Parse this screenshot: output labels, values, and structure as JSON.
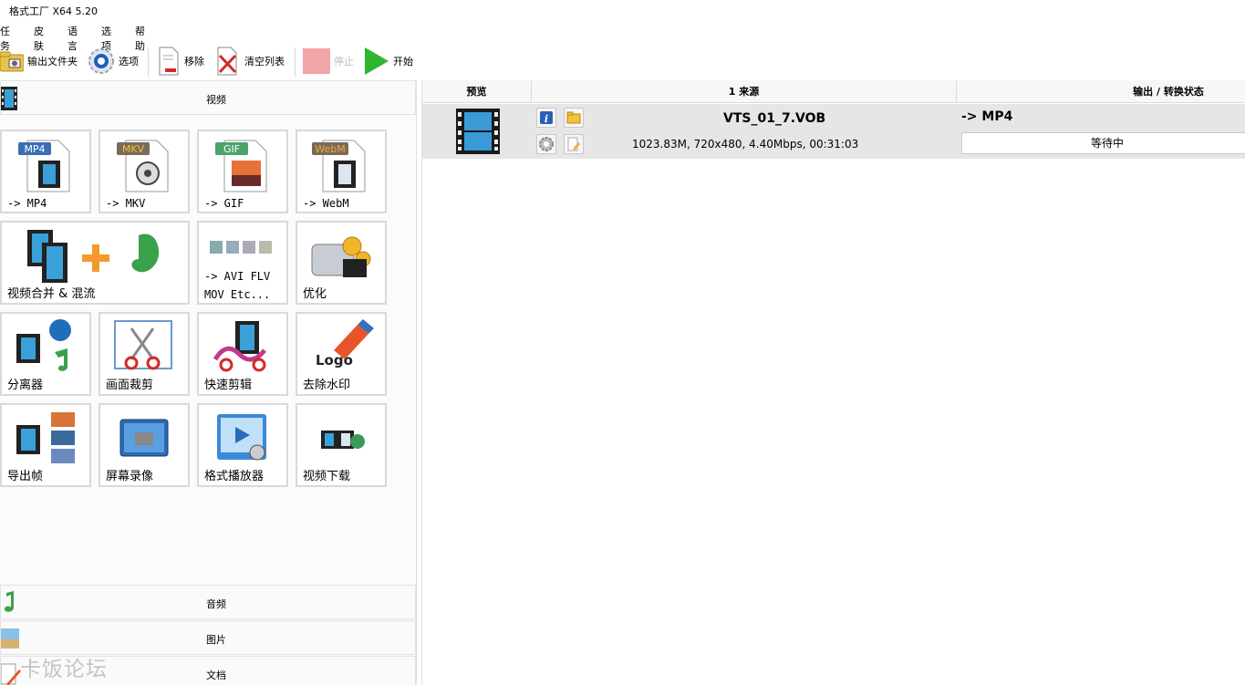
{
  "window": {
    "title": "格式工厂 X64 5.20"
  },
  "menu": [
    "任务",
    "皮肤",
    "语言",
    "选项",
    "帮助"
  ],
  "toolbar": {
    "output_folder": "输出文件夹",
    "options": "选项",
    "remove": "移除",
    "clear_list": "清空列表",
    "stop": "停止",
    "start": "开始"
  },
  "categories": {
    "video": "视频",
    "audio": "音频",
    "image": "图片",
    "document": "文档"
  },
  "video_tiles": [
    {
      "label": "-> MP4",
      "badge": "MP4"
    },
    {
      "label": "-> MKV",
      "badge": "MKV"
    },
    {
      "label": "-> GIF",
      "badge": "GIF"
    },
    {
      "label": "-> WebM",
      "badge": "WebM"
    },
    {
      "label": "视频合并 & 混流"
    },
    {
      "label": "-> AVI FLV",
      "label2": "MOV Etc..."
    },
    {
      "label": "优化"
    },
    {
      "label": "分离器"
    },
    {
      "label": "画面裁剪"
    },
    {
      "label": "快速剪辑"
    },
    {
      "label": "去除水印",
      "badge": "Logo"
    },
    {
      "label": "导出帧"
    },
    {
      "label": "屏幕录像"
    },
    {
      "label": "格式播放器"
    },
    {
      "label": "视频下载"
    }
  ],
  "grid": {
    "columns": [
      "预览",
      "1 来源",
      "输出 / 转换状态"
    ],
    "rows": [
      {
        "filename": "VTS_01_7.VOB",
        "info": "1023.83M, 720x480, 4.40Mbps, 00:31:03",
        "output": "-> MP4",
        "status": "等待中"
      }
    ]
  },
  "watermark": "卡饭论坛",
  "colors": {
    "accent_green": "#2fb52f",
    "stop_disabled": "#f2a5a5",
    "row_bg": "#e6e6e6"
  }
}
